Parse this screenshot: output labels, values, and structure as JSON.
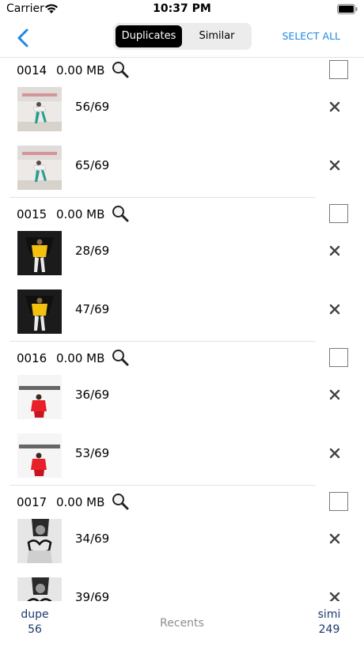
{
  "status_bar": {
    "carrier": "Carrier",
    "time": "10:37 PM"
  },
  "nav": {
    "back_icon": "chevron-left-icon",
    "segments": [
      "Duplicates",
      "Similar"
    ],
    "selected_segment": "Duplicates",
    "select_all": "SELECT ALL",
    "accent_color": "#1e88e5"
  },
  "groups": [
    {
      "id": "0014",
      "size": "0.00 MB",
      "items": [
        {
          "count": "56/69",
          "thumb": "dancer-white-room"
        },
        {
          "count": "65/69",
          "thumb": "dancer-white-room"
        }
      ]
    },
    {
      "id": "0015",
      "size": "0.00 MB",
      "items": [
        {
          "count": "28/69",
          "thumb": "yellow-shirt-dark-wall"
        },
        {
          "count": "47/69",
          "thumb": "yellow-shirt-dark-wall"
        }
      ]
    },
    {
      "id": "0016",
      "size": "0.00 MB",
      "items": [
        {
          "count": "36/69",
          "thumb": "red-outfit-text-wall"
        },
        {
          "count": "53/69",
          "thumb": "red-outfit-text-wall"
        }
      ]
    },
    {
      "id": "0017",
      "size": "0.00 MB",
      "items": [
        {
          "count": "34/69",
          "thumb": "bw-portrait"
        },
        {
          "count": "39/69",
          "thumb": "bw-portrait"
        }
      ]
    }
  ],
  "bottom_bar": {
    "dupe_label": "dupe",
    "dupe_count": "56",
    "recents": "Recents",
    "simi_label": "simi",
    "simi_count": "249"
  }
}
